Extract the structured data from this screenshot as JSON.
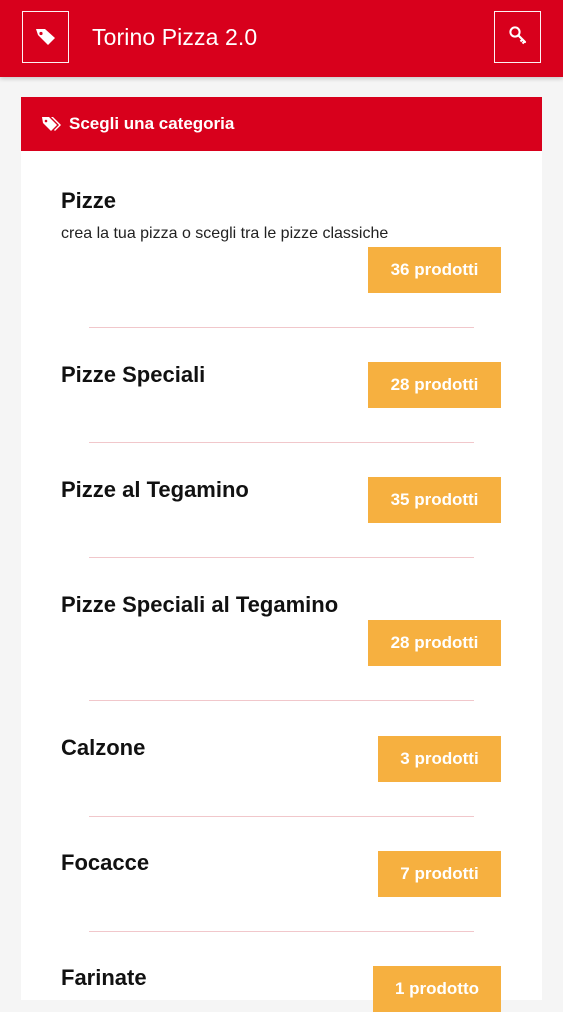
{
  "app": {
    "title": "Torino Pizza 2.0"
  },
  "panel": {
    "title": "Scegli una categoria"
  },
  "categories": [
    {
      "name": "Pizze",
      "description": "crea la tua pizza o scegli tra le pizze classiche",
      "count": "36 prodotti"
    },
    {
      "name": "Pizze Speciali",
      "count": "28 prodotti"
    },
    {
      "name": "Pizze al Tegamino",
      "count": "35 prodotti"
    },
    {
      "name": "Pizze Speciali al Tegamino",
      "count": "28 prodotti"
    },
    {
      "name": "Calzone",
      "count": "3 prodotti"
    },
    {
      "name": "Focacce",
      "count": "7 prodotti"
    },
    {
      "name": "Farinate",
      "count": "1 prodotto"
    }
  ],
  "colors": {
    "brand_red": "#d8001c",
    "badge_orange": "#f6b040"
  },
  "icons": {
    "left": "tag-icon",
    "right": "key-icon",
    "panel": "tags-icon"
  }
}
